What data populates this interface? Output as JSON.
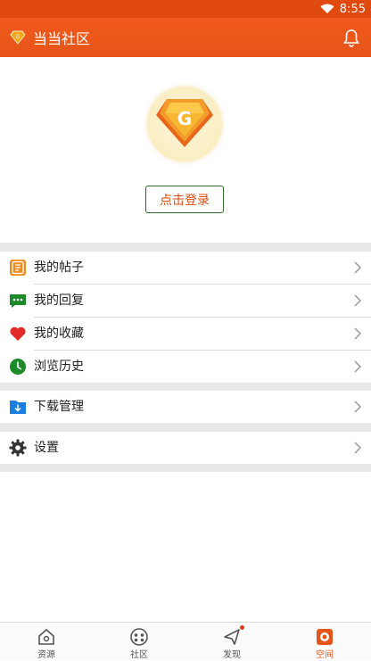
{
  "status_bar": {
    "time": "8:55"
  },
  "app_bar": {
    "title": "当当社区"
  },
  "profile": {
    "avatar_letter": "G",
    "login_label": "点击登录"
  },
  "menu": {
    "group1": [
      {
        "label": "我的帖子",
        "icon": "posts-icon",
        "color": "#f08a1c"
      },
      {
        "label": "我的回复",
        "icon": "reply-icon",
        "color": "#1d8a2a"
      },
      {
        "label": "我的收藏",
        "icon": "heart-icon",
        "color": "#e22a2a"
      },
      {
        "label": "浏览历史",
        "icon": "clock-icon",
        "color": "#1d8a2a"
      }
    ],
    "group2": [
      {
        "label": "下载管理",
        "icon": "download-icon",
        "color": "#1a7fe0"
      }
    ],
    "group3": [
      {
        "label": "设置",
        "icon": "gear-icon",
        "color": "#333333"
      }
    ]
  },
  "bottom_nav": [
    {
      "label": "资源",
      "icon": "home-icon",
      "active": false
    },
    {
      "label": "社区",
      "icon": "community-icon",
      "active": false
    },
    {
      "label": "发现",
      "icon": "discover-icon",
      "active": false,
      "badge_dot": true
    },
    {
      "label": "空间",
      "icon": "space-icon",
      "active": true
    }
  ],
  "colors": {
    "accent": "#e8551a",
    "login_border": "#2f6b2a",
    "separator": "#e8e8e8"
  }
}
